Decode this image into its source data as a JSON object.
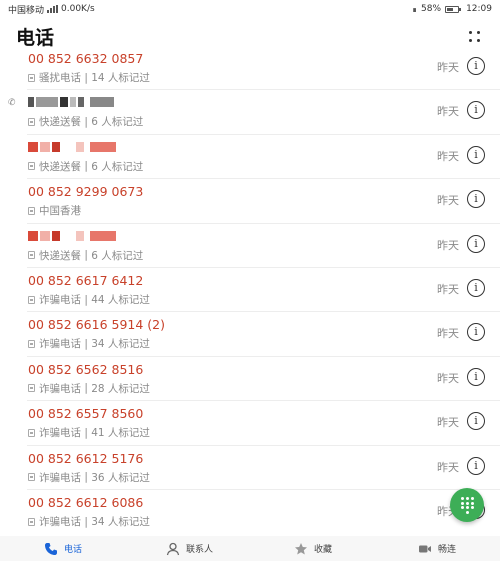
{
  "status_bar": {
    "carrier": "中国移动",
    "speed": "0.00K/s",
    "battery": "58%",
    "time": "12:09"
  },
  "header": {
    "title": "电话"
  },
  "calls": [
    {
      "number": "00 852 6632 0857",
      "tag": "骚扰电话",
      "count": "14 人标记过",
      "time": "昨天",
      "redacted": false
    },
    {
      "number": "",
      "tag": "快递送餐",
      "count": "6 人标记过",
      "time": "昨天",
      "redacted": true,
      "outgoing": true
    },
    {
      "number": "",
      "tag": "快递送餐",
      "count": "6 人标记过",
      "time": "昨天",
      "redacted": true
    },
    {
      "number": "00 852 9299 0673",
      "tag": "中国香港",
      "count": "",
      "time": "昨天",
      "redacted": false
    },
    {
      "number": "",
      "tag": "快递送餐",
      "count": "6 人标记过",
      "time": "昨天",
      "redacted": true
    },
    {
      "number": "00 852 6617 6412",
      "tag": "诈骗电话",
      "count": "44 人标记过",
      "time": "昨天",
      "redacted": false
    },
    {
      "number": "00 852 6616 5914 (2)",
      "tag": "诈骗电话",
      "count": "34 人标记过",
      "time": "昨天",
      "redacted": false
    },
    {
      "number": "00 852 6562 8516",
      "tag": "诈骗电话",
      "count": "28 人标记过",
      "time": "昨天",
      "redacted": false
    },
    {
      "number": "00 852 6557 8560",
      "tag": "诈骗电话",
      "count": "41 人标记过",
      "time": "昨天",
      "redacted": false
    },
    {
      "number": "00 852 6612 5176",
      "tag": "诈骗电话",
      "count": "36 人标记过",
      "time": "昨天",
      "redacted": false
    },
    {
      "number": "00 852 6612 6086",
      "tag": "诈骗电话",
      "count": "34 人标记过",
      "time": "昨天",
      "redacted": false
    }
  ],
  "bottom_nav": [
    {
      "label": "电话",
      "icon": "phone-icon",
      "active": true
    },
    {
      "label": "联系人",
      "icon": "contacts-icon",
      "active": false
    },
    {
      "label": "收藏",
      "icon": "star-icon",
      "active": false
    },
    {
      "label": "畅连",
      "icon": "video-call-icon",
      "active": false
    }
  ],
  "colors": {
    "number": "#c8412a",
    "accent": "#1a64d8",
    "fab": "#3dae57"
  }
}
